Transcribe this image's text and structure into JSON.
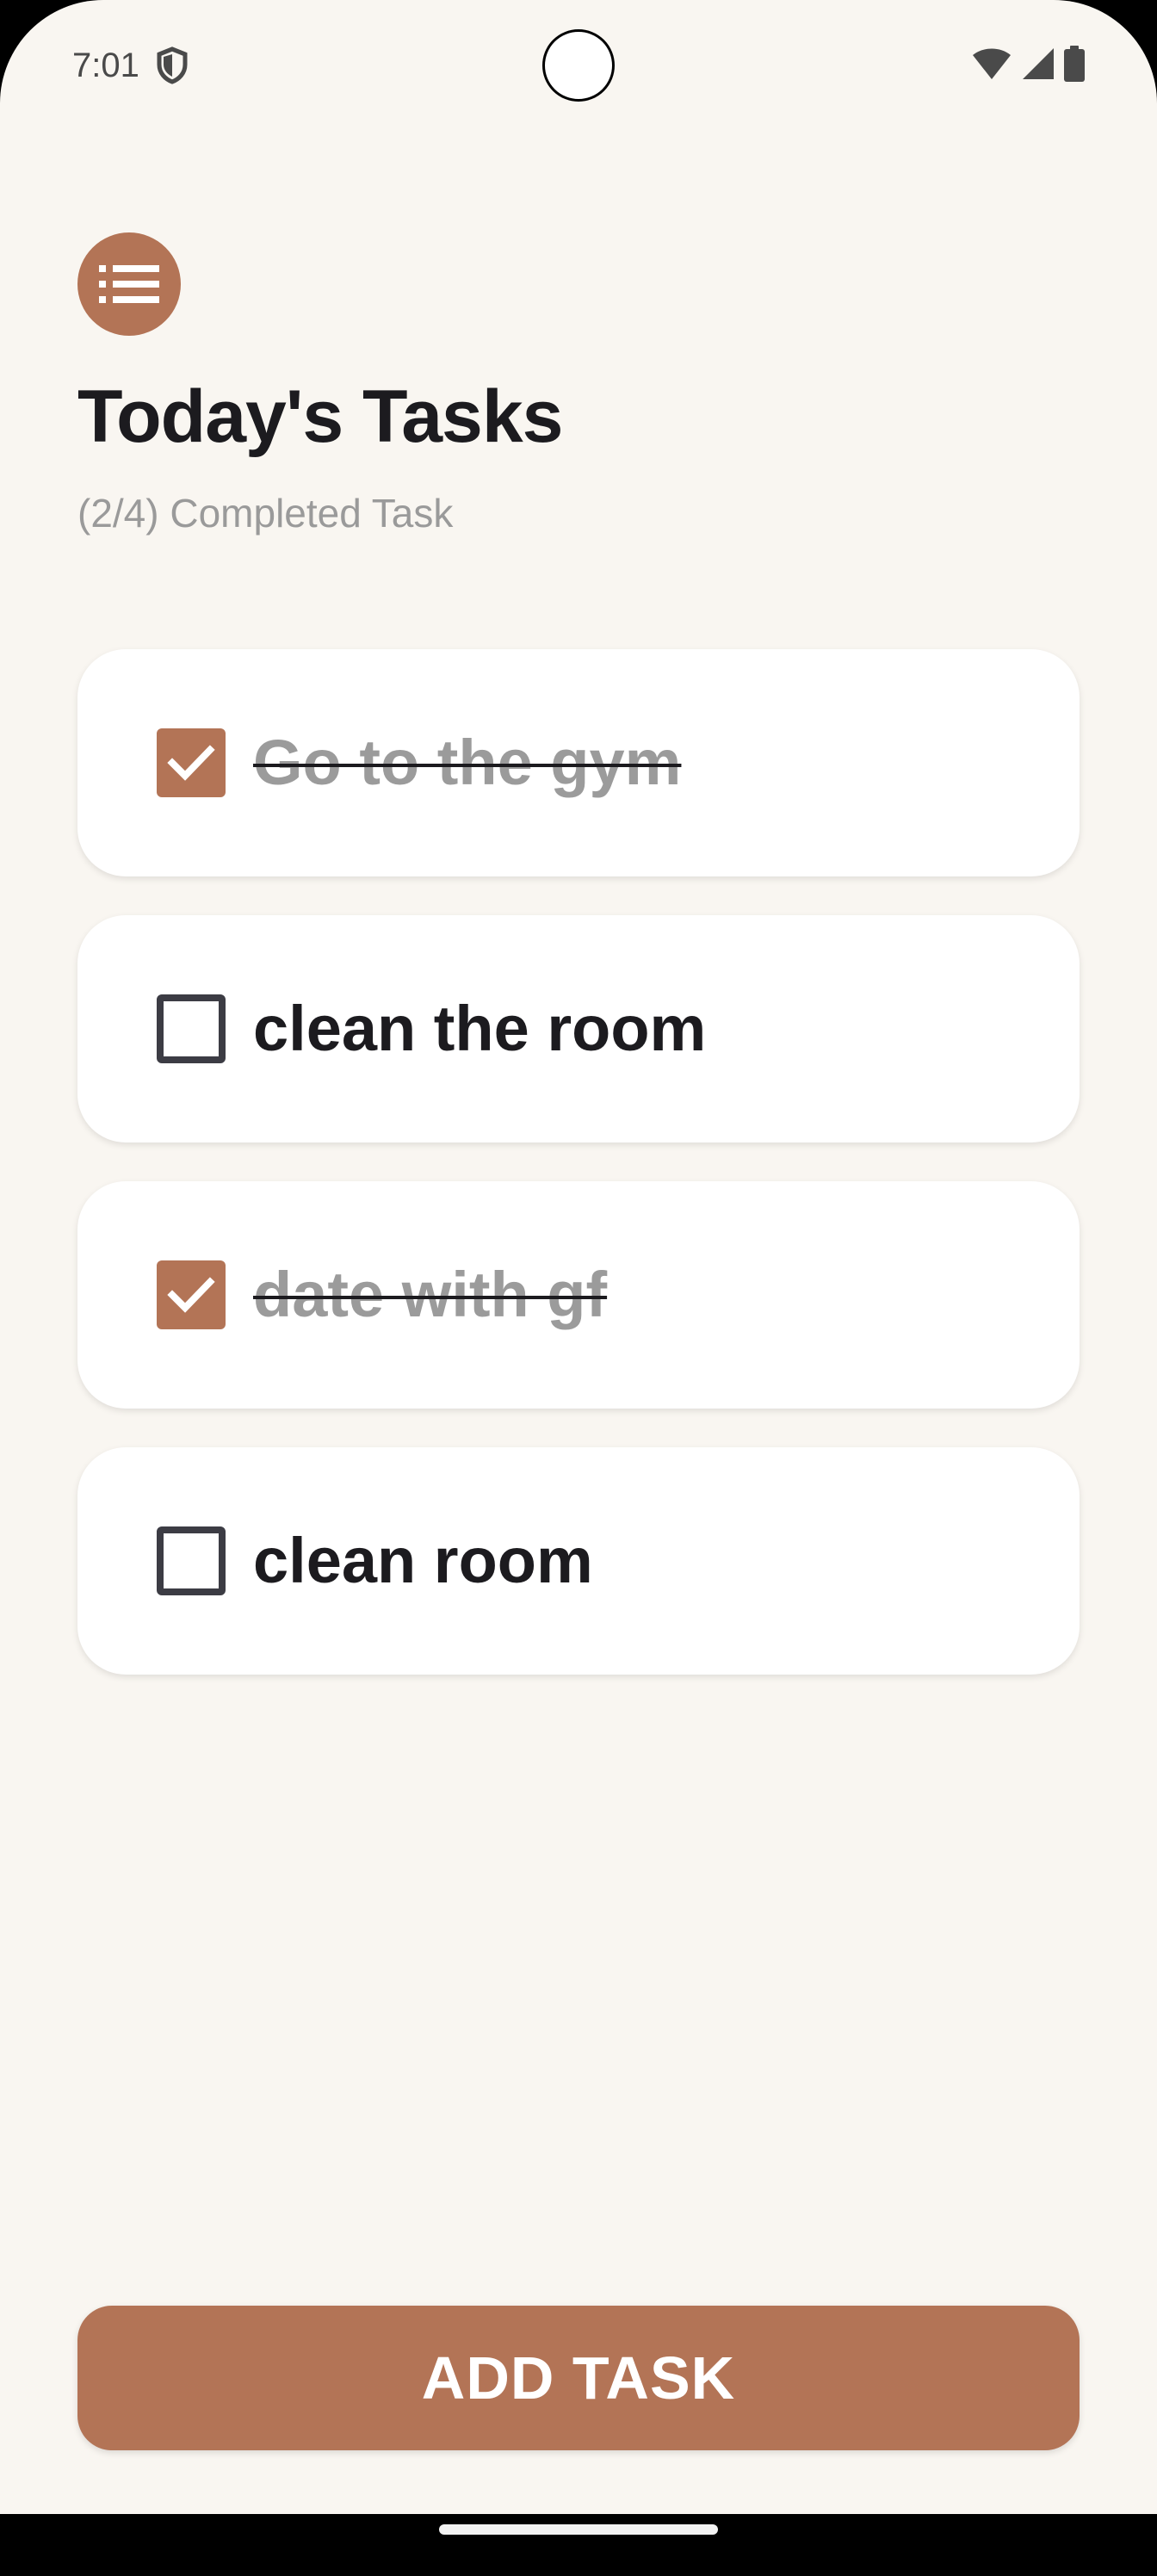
{
  "status_bar": {
    "time": "7:01",
    "icons": [
      "shield-icon",
      "wifi-icon",
      "cellular-icon",
      "battery-icon"
    ]
  },
  "header": {
    "icon": "list-icon",
    "title": "Today's Tasks",
    "subtitle": "(2/4) Completed Task"
  },
  "tasks": [
    {
      "label": "Go to the gym",
      "completed": true
    },
    {
      "label": "clean the room",
      "completed": false
    },
    {
      "label": "date with gf",
      "completed": true
    },
    {
      "label": "clean room",
      "completed": false
    }
  ],
  "add_button": {
    "label": "ADD TASK"
  },
  "colors": {
    "accent": "#b37456",
    "background": "#f9f6f1",
    "card": "#ffffff",
    "text_primary": "#1c1b1f",
    "text_secondary": "#9a9a9a"
  }
}
